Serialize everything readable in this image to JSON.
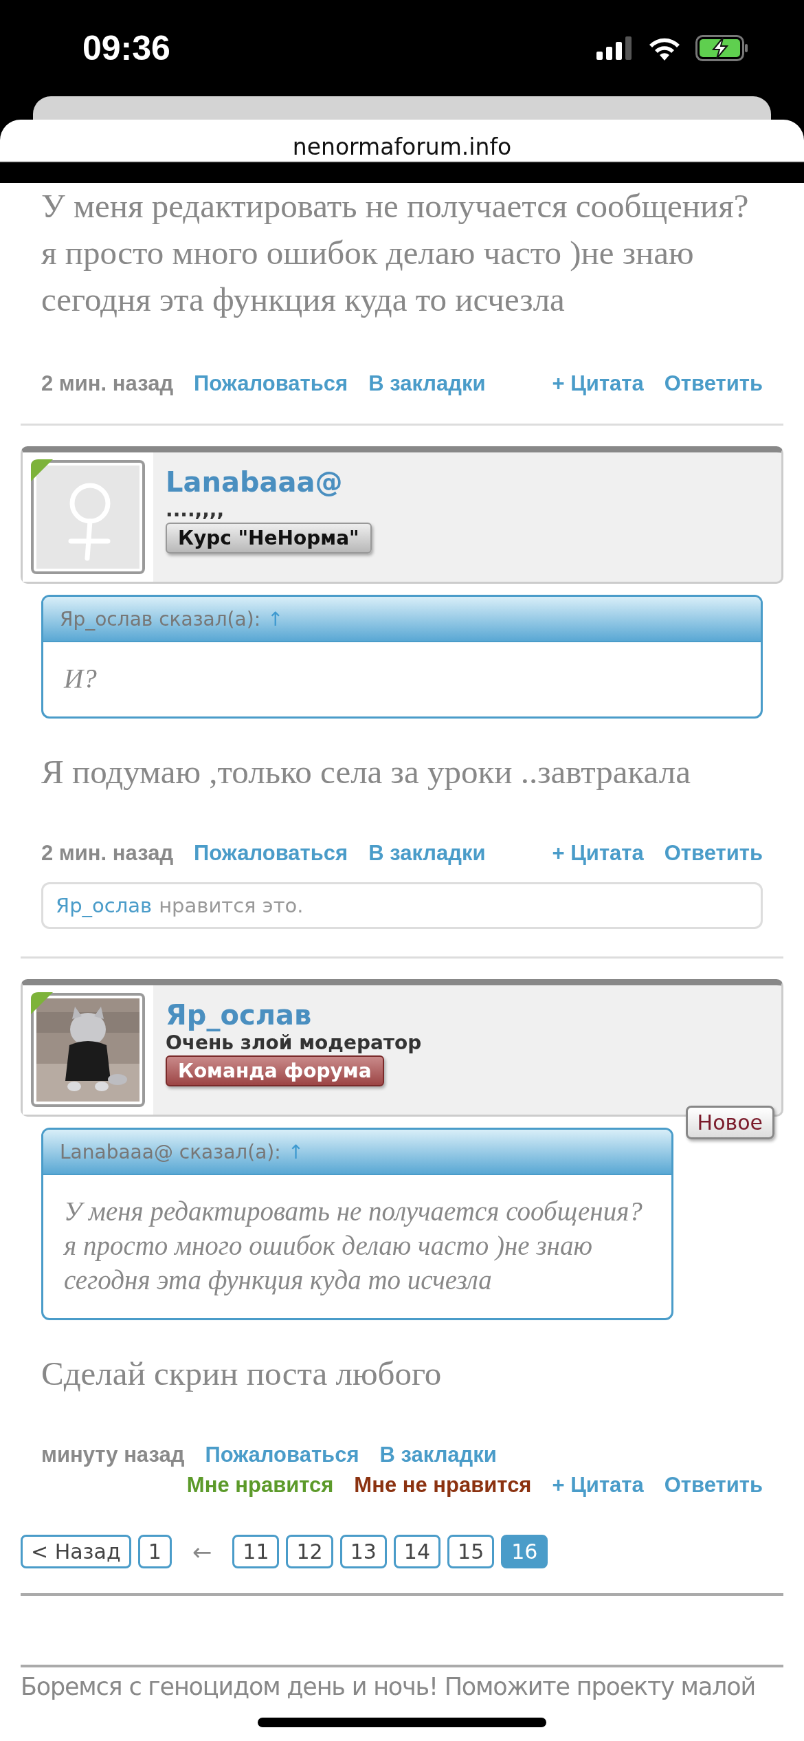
{
  "status_bar": {
    "time": "09:36"
  },
  "browser": {
    "url": "nenormaforum.info"
  },
  "posts": [
    {
      "body": "У меня редактировать не получается сообщения? я просто много ошибок делаю часто )не знаю сегодня эта функция куда то исчезла",
      "time": "2 мин. назад",
      "left_actions": [
        {
          "kind": "link",
          "label": "Пожаловаться"
        },
        {
          "kind": "link",
          "label": "В закладки"
        }
      ],
      "right_actions": [
        {
          "kind": "link",
          "label": "+ Цитата"
        },
        {
          "kind": "link",
          "label": "Ответить"
        }
      ]
    },
    {
      "author": {
        "name": "Lanabaaa@",
        "title": "....,,,,",
        "online": true,
        "avatar": {
          "kind": "placeholder"
        },
        "badge": {
          "kind": "course",
          "label": "Курс \"НеНорма\""
        }
      },
      "quote": {
        "header": "Яр_ослав сказал(а):",
        "arrow": "↑",
        "text": "И?"
      },
      "body": "Я подумаю ,только села за уроки ..завтракала",
      "time": "2 мин. назад",
      "left_actions": [
        {
          "kind": "link",
          "label": "Пожаловаться"
        },
        {
          "kind": "link",
          "label": "В закладки"
        }
      ],
      "right_actions": [
        {
          "kind": "link",
          "label": "+ Цитата"
        },
        {
          "kind": "link",
          "label": "Ответить"
        }
      ],
      "likes": {
        "user": "Яр_ослав",
        "text": "нравится это."
      }
    },
    {
      "author": {
        "name": "Яр_ослав",
        "title": "Очень злой модератор",
        "online": true,
        "badge": {
          "kind": "team",
          "label": "Команда форума"
        },
        "new_label": "Новое"
      },
      "quote": {
        "header": "Lanabaaa@ сказал(а):",
        "arrow": "↑",
        "text": "У меня редактировать не получается сообщения?я просто много ошибок делаю часто )не знаю сегодня эта функция куда то исчезла"
      },
      "body": "Сделай скрин поста любого",
      "time": "минуту назад",
      "left_actions": [
        {
          "kind": "link",
          "label": "Пожаловаться"
        },
        {
          "kind": "link",
          "label": "В закладки"
        }
      ],
      "right_actions": [
        {
          "kind": "like",
          "label": "Мне нравится"
        },
        {
          "kind": "dislike",
          "label": "Мне не нравится"
        },
        {
          "kind": "link",
          "label": "+ Цитата"
        },
        {
          "kind": "link",
          "label": "Ответить"
        }
      ]
    }
  ],
  "pagination": [
    {
      "kind": "prev",
      "label": "< Назад",
      "selected": false
    },
    {
      "kind": "page",
      "label": "1",
      "selected": false
    },
    {
      "kind": "gap",
      "label": "←"
    },
    {
      "kind": "page",
      "label": "11",
      "selected": false
    },
    {
      "kind": "page",
      "label": "12",
      "selected": false
    },
    {
      "kind": "page",
      "label": "13",
      "selected": false
    },
    {
      "kind": "page",
      "label": "14",
      "selected": false
    },
    {
      "kind": "page",
      "label": "15",
      "selected": false
    },
    {
      "kind": "page",
      "label": "16",
      "selected": true
    }
  ],
  "footer": {
    "text": "Боремся с геноцидом день и ночь! Поможите проекту малой"
  }
}
